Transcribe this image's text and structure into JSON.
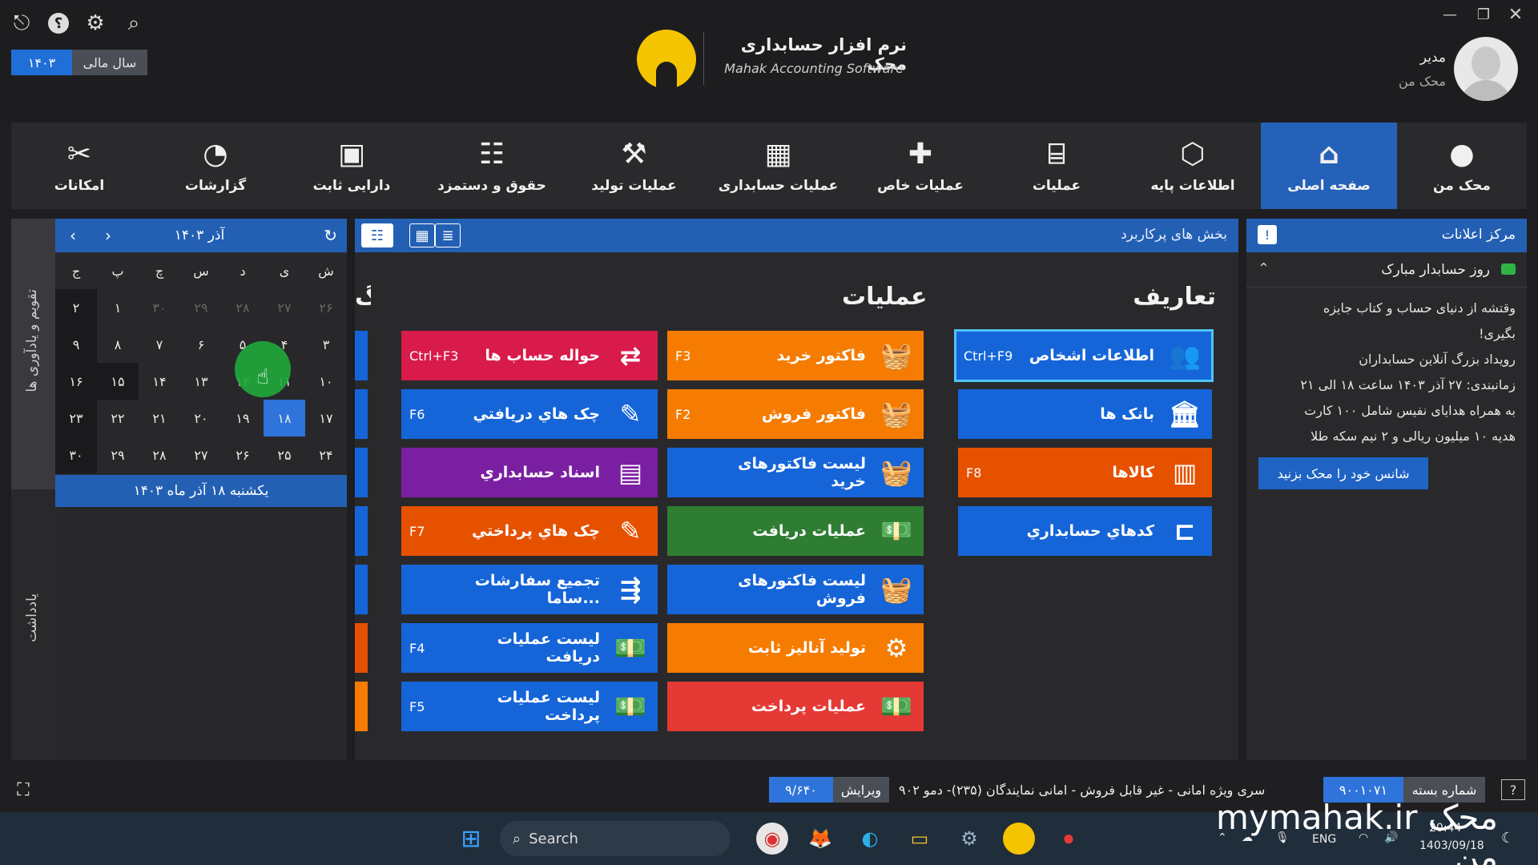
{
  "header": {
    "app_name": "نرم افزار حسابداری محک",
    "app_name_en": "Mahak Accounting Software",
    "fiscal_label": "سال مالی",
    "fiscal_year": "۱۴۰۳",
    "user_role": "مدیر",
    "user_company": "محک من",
    "icons": [
      "logout-icon",
      "help-icon",
      "gear-icon",
      "search-icon"
    ]
  },
  "nav": [
    {
      "label": "محک من",
      "icon": "mahak-icon",
      "active": false
    },
    {
      "label": "صفحه اصلی",
      "icon": "home-icon",
      "active": true
    },
    {
      "label": "اطلاعات پایه",
      "icon": "box-icon",
      "active": false
    },
    {
      "label": "عملیات",
      "icon": "register-icon",
      "active": false
    },
    {
      "label": "عملیات خاص",
      "icon": "puzzle-icon",
      "active": false
    },
    {
      "label": "عملیات حسابداری",
      "icon": "calculator-icon",
      "active": false
    },
    {
      "label": "عملیات تولید",
      "icon": "factory-icon",
      "active": false
    },
    {
      "label": "حقوق و دستمزد",
      "icon": "payroll-icon",
      "active": false
    },
    {
      "label": "دارایی ثابت",
      "icon": "asset-icon",
      "active": false
    },
    {
      "label": "گزارشات",
      "icon": "report-icon",
      "active": false
    },
    {
      "label": "امکانات",
      "icon": "tools-icon",
      "active": false
    }
  ],
  "calendar": {
    "side_tab_top": "تقویم و یادآوری ها",
    "side_tab_bottom": "یادداشت",
    "month_label": "آذر ۱۴۰۳",
    "weekdays": [
      "ش",
      "ی",
      "د",
      "س",
      "چ",
      "پ",
      "ج"
    ],
    "weeks": [
      [
        "۲۶",
        "۲۷",
        "۲۸",
        "۲۹",
        "۳۰",
        "۱",
        "۲"
      ],
      [
        "۳",
        "۴",
        "۵",
        "۶",
        "۷",
        "۸",
        "۹"
      ],
      [
        "۱۰",
        "۱۱",
        "۱۲",
        "۱۳",
        "۱۴",
        "۱۵",
        "۱۶"
      ],
      [
        "۱۷",
        "۱۸",
        "۱۹",
        "۲۰",
        "۲۱",
        "۲۲",
        "۲۳"
      ],
      [
        "۲۴",
        "۲۵",
        "۲۶",
        "۲۷",
        "۲۸",
        "۲۹",
        "۳۰"
      ]
    ],
    "today_text": "یکشنبه ۱۸ آذر ماه ۱۴۰۳"
  },
  "center": {
    "title": "بخش های پرکاربرد",
    "sections": {
      "definitions": "تعاریف",
      "operations": "عملیات",
      "cut_heading": "گ"
    },
    "definitions_tiles": [
      {
        "label": "اطلاعات اشخاص",
        "key": "Ctrl+F9",
        "icon": "people-icon"
      },
      {
        "label": "بانک ها",
        "key": "",
        "icon": "bank-icon"
      },
      {
        "label": "کالاها",
        "key": "F8",
        "icon": "goods-icon"
      },
      {
        "label": "کدهاي حسابداري",
        "key": "",
        "icon": "tree-icon"
      }
    ],
    "operations_col1": [
      {
        "label": "فاکتور خرید",
        "key": "F3",
        "icon": "basket-icon"
      },
      {
        "label": "فاکتور فروش",
        "key": "F2",
        "icon": "basket-icon"
      },
      {
        "label": "لیست فاکتورهای خرید",
        "key": "",
        "icon": "basket-list-icon"
      },
      {
        "label": "عملیات دریافت",
        "key": "",
        "icon": "receive-icon"
      },
      {
        "label": "لیست فاکتورهای فروش",
        "key": "",
        "icon": "basket-list-icon"
      },
      {
        "label": "تولید آنالیز ثابت",
        "key": "",
        "icon": "gear-icon"
      },
      {
        "label": "عملیات پرداخت",
        "key": "",
        "icon": "pay-icon"
      }
    ],
    "operations_col2": [
      {
        "label": "حواله حساب ها",
        "key": "Ctrl+F3",
        "icon": "transfer-icon"
      },
      {
        "label": "چک هاي دريافتي",
        "key": "F6",
        "icon": "cheque-icon"
      },
      {
        "label": "اسناد حسابداري",
        "key": "",
        "icon": "documents-icon"
      },
      {
        "label": "چک هاي پرداختي",
        "key": "F7",
        "icon": "cheque-icon"
      },
      {
        "label": "تجمیع سفارشات ساما...",
        "key": "",
        "icon": "merge-icon"
      },
      {
        "label": "لیست عملیات دریافت",
        "key": "F4",
        "icon": "receive-list-icon"
      },
      {
        "label": "لیست عملیات پرداخت",
        "key": "F5",
        "icon": "pay-list-icon"
      }
    ]
  },
  "notice": {
    "title": "مرکز اعلانات",
    "subtitle": "روز حسابدار مبارک",
    "lines": [
      "وقتشه از دنیای حساب و کتاب جایزه",
      "بگیری!",
      "رویداد بزرگ آنلاین حسابداران",
      "زمانبندی: ۲۷ آذر ۱۴۰۳ ساعت ۱۸ الی ۲۱",
      "به همراه هدایای نفیس شامل ۱۰۰ کارت",
      "هدیه ۱۰ میلیون ریالی و ۲ نیم سکه طلا"
    ],
    "button": "شانس خود را محک بزنید"
  },
  "status": {
    "package_label": "شماره بسته",
    "package_number": "۹۰۰۱۰۷۱",
    "series_text": "سری ویژه امانی - غیر قابل فروش - امانی نمایندگان (۲۳۵)- دمو ۹۰۲",
    "version_label": "ویرایش",
    "version_number": "۹/۶۴۰"
  },
  "taskbar": {
    "search_placeholder": "Search",
    "lang": "ENG",
    "time": "20:44",
    "date": "1403/09/18"
  },
  "watermark": "mymahak.ir محک من"
}
